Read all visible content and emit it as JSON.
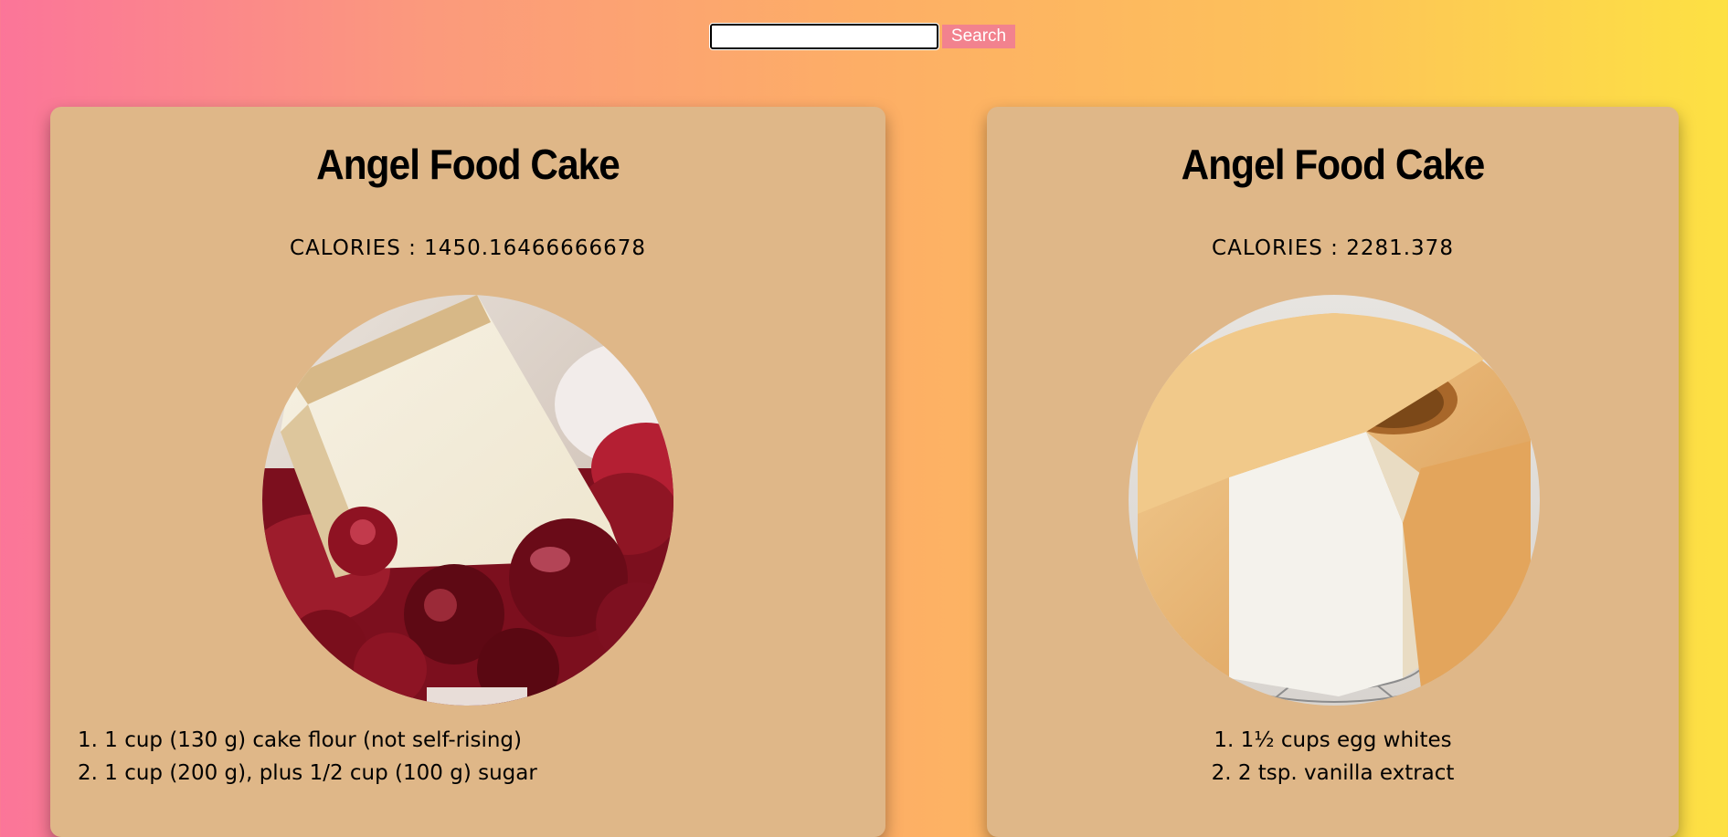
{
  "search": {
    "value": "",
    "placeholder": "",
    "button_label": "Search"
  },
  "recipes": [
    {
      "title": "Angel Food Cake",
      "calories": "CALORIES : 1450.16466666678",
      "image": "angel-food-cake-slice-with-cherries",
      "ingredients": [
        "1. 1 cup (130 g) cake flour (not self-rising)",
        "2. 1 cup (200 g), plus 1/2 cup (100 g) sugar"
      ]
    },
    {
      "title": "Angel Food Cake",
      "calories": "CALORIES : 2281.378",
      "image": "angel-food-cake-on-cooling-rack",
      "ingredients": [
        "1. 1½ cups egg whites",
        "2. 2 tsp. vanilla extract"
      ]
    }
  ],
  "colors": {
    "background_left": "#fb7599",
    "background_right": "#fde143",
    "card": "#dfb788",
    "search_button": "#f2828e"
  }
}
